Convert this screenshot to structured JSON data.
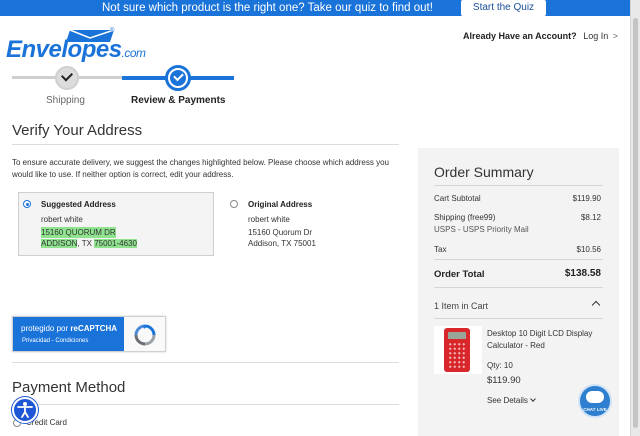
{
  "promo": {
    "text": "Not sure which product is the right one? Take our quiz to find out!",
    "cta": "Start the Quiz"
  },
  "header": {
    "logo_text": "Envelopes",
    "logo_dotcom": ".com",
    "logo_reg": "®",
    "account_question": "Already Have an Account?",
    "login": "Log In",
    "login_chevron": ">"
  },
  "progress": {
    "steps": [
      {
        "label": "Shipping",
        "state": "complete"
      },
      {
        "label": "Review & Payments",
        "state": "active"
      }
    ]
  },
  "verify": {
    "title": "Verify Your Address",
    "description": "To ensure accurate delivery, we suggest the changes highlighted below. Please choose which address you would like to use. If neither option is correct, edit your address.",
    "suggested": {
      "heading": "Suggested Address",
      "selected": true,
      "name": "robert white",
      "street": "15160 QUORUM DR",
      "city": "ADDISON",
      "state": ", TX ",
      "zip": "75001-4630"
    },
    "original": {
      "heading": "Original Address",
      "selected": false,
      "name": "robert white",
      "street": "15160 Quorum Dr",
      "city_line": "Addison, TX 75001"
    }
  },
  "recaptcha": {
    "line1_prefix": "protegido por ",
    "line1_brand": "reCAPTCHA",
    "line2": "Privacidad - Condiciones"
  },
  "payment": {
    "title": "Payment Method",
    "option": "Credit Card"
  },
  "summary": {
    "title": "Order Summary",
    "rows": [
      {
        "label": "Cart Subtotal",
        "value": "$119.90"
      },
      {
        "label": "Shipping (free99)",
        "sub": "USPS - USPS Priority Mail",
        "value": "$8.12"
      },
      {
        "label": "Tax",
        "value": "$10.56"
      }
    ],
    "total_label": "Order Total",
    "total_value": "$138.58",
    "items_label": "1 Item in Cart",
    "item": {
      "name": "Desktop 10 Digit LCD Display Calculator - Red",
      "qty": "Qty: 10",
      "price": "$119.90",
      "details": "See Details"
    }
  },
  "chat": {
    "label": "CHAT LIVE"
  },
  "colors": {
    "brand_blue": "#1a73d9",
    "highlight": "#8fe38f",
    "panel": "#f3f3f3"
  }
}
